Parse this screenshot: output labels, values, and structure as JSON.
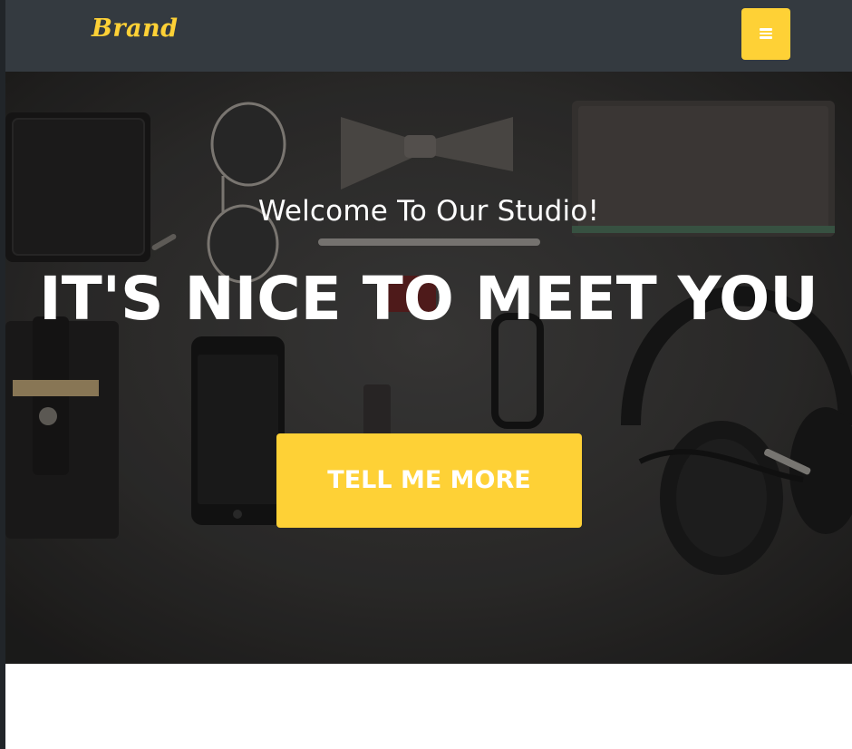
{
  "navbar": {
    "brand": "Brand",
    "menu_icon": "bars-icon"
  },
  "hero": {
    "subheading": "Welcome To Our Studio!",
    "heading": "IT'S NICE TO MEET YOU",
    "button_label": "TELL ME MORE",
    "background_image": "dark flat-lay of wallet, sunglasses, bow tie, notebook, pen, phone, glasses, headphones"
  },
  "colors": {
    "accent": "#fed136",
    "navbar_bg": "#343a40",
    "page_bg": "#ffffff",
    "text_light": "#ffffff"
  }
}
